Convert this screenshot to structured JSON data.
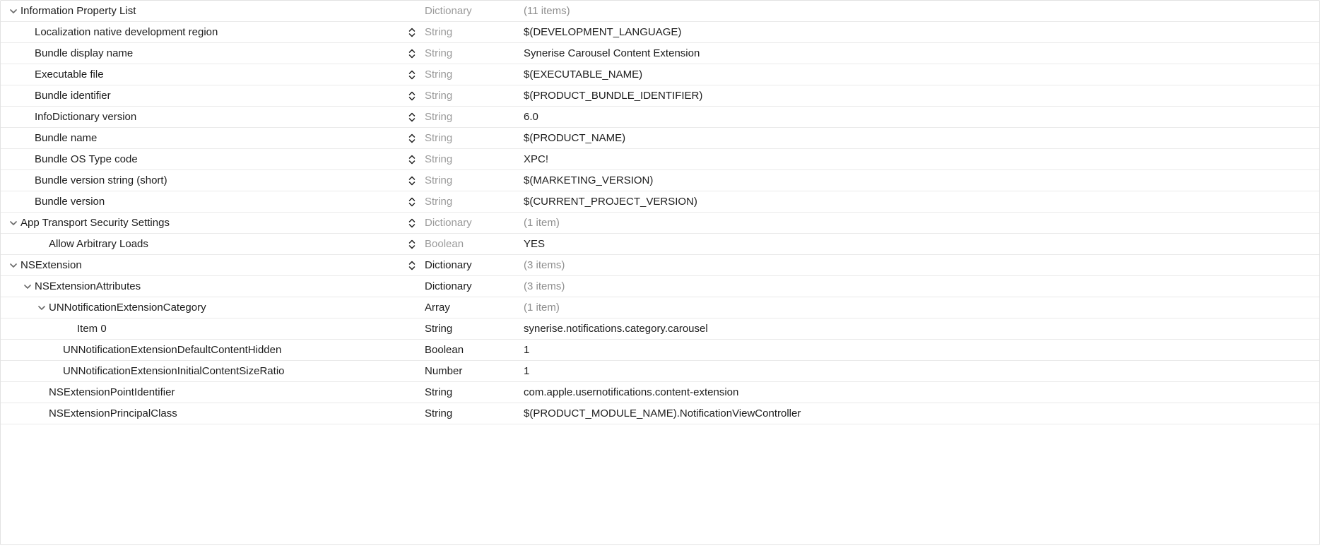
{
  "rows": [
    {
      "indent": 0,
      "chev": true,
      "key": "Information Property List",
      "stepper": false,
      "type": "Dictionary",
      "typeGrey": true,
      "value": "(11 items)",
      "valueGrey": true
    },
    {
      "indent": 1,
      "chev": false,
      "key": "Localization native development region",
      "stepper": true,
      "type": "String",
      "typeGrey": true,
      "value": "$(DEVELOPMENT_LANGUAGE)",
      "valueGrey": false
    },
    {
      "indent": 1,
      "chev": false,
      "key": "Bundle display name",
      "stepper": true,
      "type": "String",
      "typeGrey": true,
      "value": "Synerise Carousel Content Extension",
      "valueGrey": false
    },
    {
      "indent": 1,
      "chev": false,
      "key": "Executable file",
      "stepper": true,
      "type": "String",
      "typeGrey": true,
      "value": "$(EXECUTABLE_NAME)",
      "valueGrey": false
    },
    {
      "indent": 1,
      "chev": false,
      "key": "Bundle identifier",
      "stepper": true,
      "type": "String",
      "typeGrey": true,
      "value": "$(PRODUCT_BUNDLE_IDENTIFIER)",
      "valueGrey": false
    },
    {
      "indent": 1,
      "chev": false,
      "key": "InfoDictionary version",
      "stepper": true,
      "type": "String",
      "typeGrey": true,
      "value": "6.0",
      "valueGrey": false
    },
    {
      "indent": 1,
      "chev": false,
      "key": "Bundle name",
      "stepper": true,
      "type": "String",
      "typeGrey": true,
      "value": "$(PRODUCT_NAME)",
      "valueGrey": false
    },
    {
      "indent": 1,
      "chev": false,
      "key": "Bundle OS Type code",
      "stepper": true,
      "type": "String",
      "typeGrey": true,
      "value": "XPC!",
      "valueGrey": false
    },
    {
      "indent": 1,
      "chev": false,
      "key": "Bundle version string (short)",
      "stepper": true,
      "type": "String",
      "typeGrey": true,
      "value": "$(MARKETING_VERSION)",
      "valueGrey": false
    },
    {
      "indent": 1,
      "chev": false,
      "key": "Bundle version",
      "stepper": true,
      "type": "String",
      "typeGrey": true,
      "value": "$(CURRENT_PROJECT_VERSION)",
      "valueGrey": false
    },
    {
      "indent": 0,
      "chev": true,
      "key": "App Transport Security Settings",
      "stepper": true,
      "type": "Dictionary",
      "typeGrey": true,
      "value": "(1 item)",
      "valueGrey": true
    },
    {
      "indent": 2,
      "chev": false,
      "key": "Allow Arbitrary Loads",
      "stepper": true,
      "type": "Boolean",
      "typeGrey": true,
      "value": "YES",
      "valueGrey": false
    },
    {
      "indent": 0,
      "chev": true,
      "key": "NSExtension",
      "stepper": true,
      "type": "Dictionary",
      "typeGrey": false,
      "value": "(3 items)",
      "valueGrey": true
    },
    {
      "indent": 1,
      "chev": true,
      "key": "NSExtensionAttributes",
      "stepper": false,
      "type": "Dictionary",
      "typeGrey": false,
      "value": "(3 items)",
      "valueGrey": true
    },
    {
      "indent": 2,
      "chev": true,
      "key": "UNNotificationExtensionCategory",
      "stepper": false,
      "type": "Array",
      "typeGrey": false,
      "value": "(1 item)",
      "valueGrey": true
    },
    {
      "indent": 4,
      "chev": false,
      "key": "Item 0",
      "stepper": false,
      "type": "String",
      "typeGrey": false,
      "value": "synerise.notifications.category.carousel",
      "valueGrey": false
    },
    {
      "indent": 3,
      "chev": false,
      "key": "UNNotificationExtensionDefaultContentHidden",
      "stepper": false,
      "type": "Boolean",
      "typeGrey": false,
      "value": "1",
      "valueGrey": false
    },
    {
      "indent": 3,
      "chev": false,
      "key": "UNNotificationExtensionInitialContentSizeRatio",
      "stepper": false,
      "type": "Number",
      "typeGrey": false,
      "value": "1",
      "valueGrey": false
    },
    {
      "indent": 2,
      "chev": false,
      "key": "NSExtensionPointIdentifier",
      "stepper": false,
      "type": "String",
      "typeGrey": false,
      "value": "com.apple.usernotifications.content-extension",
      "valueGrey": false
    },
    {
      "indent": 2,
      "chev": false,
      "key": "NSExtensionPrincipalClass",
      "stepper": false,
      "type": "String",
      "typeGrey": false,
      "value": "$(PRODUCT_MODULE_NAME).NotificationViewController",
      "valueGrey": false
    }
  ]
}
